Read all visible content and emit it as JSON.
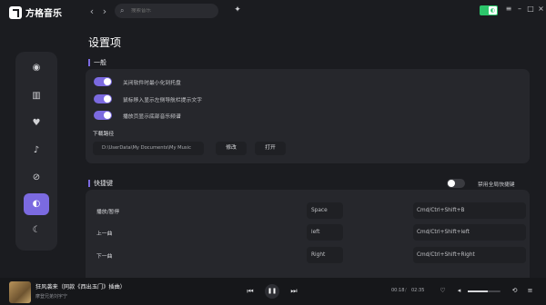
{
  "app": {
    "name": "方格音乐"
  },
  "nav": {
    "back": "‹",
    "forward": "›"
  },
  "search": {
    "placeholder": "搜索音乐"
  },
  "page": {
    "title": "设置项"
  },
  "general": {
    "title": "一般",
    "options": [
      {
        "label": "关闭软件时最小化到托盘",
        "on": true
      },
      {
        "label": "鼠标移入显示左侧导航栏提示文字",
        "on": true
      },
      {
        "label": "播放页显示底部音乐频谱",
        "on": true
      }
    ],
    "download_label": "下载路径",
    "download_path": "D:\\UserData\\My Documents\\My Music",
    "modify_btn": "修改",
    "open_btn": "打开"
  },
  "shortcuts": {
    "title": "快捷键",
    "disable_global": "禁用全局快捷键",
    "rows": [
      {
        "name": "播放/暂停",
        "local": "Space",
        "global": "Cmd/Ctrl+Shift+B"
      },
      {
        "name": "上一曲",
        "local": "left",
        "global": "Cmd/Ctrl+Shift+left"
      },
      {
        "name": "下一曲",
        "local": "Right",
        "global": "Cmd/Ctrl+Shift+Right"
      }
    ]
  },
  "player": {
    "title": "狂风袭来（同款《西出玉门》插曲）",
    "artist": "摩登兄弟刘宇宁",
    "current": "00:18",
    "total": "02:35",
    "volume": 0.62
  },
  "colors": {
    "accent": "#7b6ae0",
    "bg": "#1b1c20",
    "card": "#26272c",
    "skin_toggle": "#2cc66b"
  }
}
